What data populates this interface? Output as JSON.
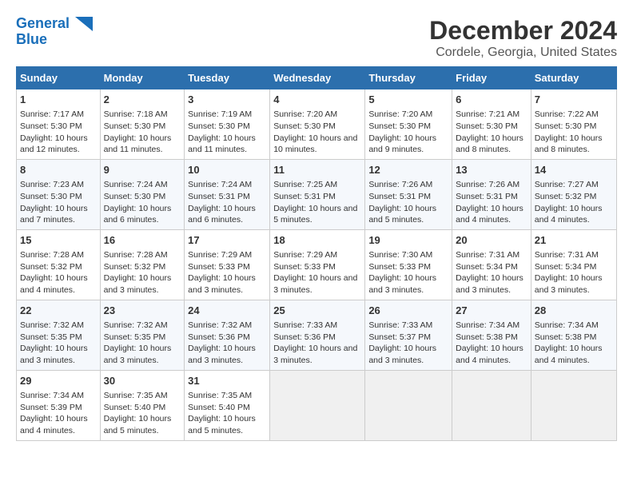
{
  "header": {
    "logo_line1": "General",
    "logo_line2": "Blue",
    "title": "December 2024",
    "subtitle": "Cordele, Georgia, United States"
  },
  "days_of_week": [
    "Sunday",
    "Monday",
    "Tuesday",
    "Wednesday",
    "Thursday",
    "Friday",
    "Saturday"
  ],
  "weeks": [
    [
      {
        "day": "1",
        "content": "Sunrise: 7:17 AM\nSunset: 5:30 PM\nDaylight: 10 hours and 12 minutes."
      },
      {
        "day": "2",
        "content": "Sunrise: 7:18 AM\nSunset: 5:30 PM\nDaylight: 10 hours and 11 minutes."
      },
      {
        "day": "3",
        "content": "Sunrise: 7:19 AM\nSunset: 5:30 PM\nDaylight: 10 hours and 11 minutes."
      },
      {
        "day": "4",
        "content": "Sunrise: 7:20 AM\nSunset: 5:30 PM\nDaylight: 10 hours and 10 minutes."
      },
      {
        "day": "5",
        "content": "Sunrise: 7:20 AM\nSunset: 5:30 PM\nDaylight: 10 hours and 9 minutes."
      },
      {
        "day": "6",
        "content": "Sunrise: 7:21 AM\nSunset: 5:30 PM\nDaylight: 10 hours and 8 minutes."
      },
      {
        "day": "7",
        "content": "Sunrise: 7:22 AM\nSunset: 5:30 PM\nDaylight: 10 hours and 8 minutes."
      }
    ],
    [
      {
        "day": "8",
        "content": "Sunrise: 7:23 AM\nSunset: 5:30 PM\nDaylight: 10 hours and 7 minutes."
      },
      {
        "day": "9",
        "content": "Sunrise: 7:24 AM\nSunset: 5:30 PM\nDaylight: 10 hours and 6 minutes."
      },
      {
        "day": "10",
        "content": "Sunrise: 7:24 AM\nSunset: 5:31 PM\nDaylight: 10 hours and 6 minutes."
      },
      {
        "day": "11",
        "content": "Sunrise: 7:25 AM\nSunset: 5:31 PM\nDaylight: 10 hours and 5 minutes."
      },
      {
        "day": "12",
        "content": "Sunrise: 7:26 AM\nSunset: 5:31 PM\nDaylight: 10 hours and 5 minutes."
      },
      {
        "day": "13",
        "content": "Sunrise: 7:26 AM\nSunset: 5:31 PM\nDaylight: 10 hours and 4 minutes."
      },
      {
        "day": "14",
        "content": "Sunrise: 7:27 AM\nSunset: 5:32 PM\nDaylight: 10 hours and 4 minutes."
      }
    ],
    [
      {
        "day": "15",
        "content": "Sunrise: 7:28 AM\nSunset: 5:32 PM\nDaylight: 10 hours and 4 minutes."
      },
      {
        "day": "16",
        "content": "Sunrise: 7:28 AM\nSunset: 5:32 PM\nDaylight: 10 hours and 3 minutes."
      },
      {
        "day": "17",
        "content": "Sunrise: 7:29 AM\nSunset: 5:33 PM\nDaylight: 10 hours and 3 minutes."
      },
      {
        "day": "18",
        "content": "Sunrise: 7:29 AM\nSunset: 5:33 PM\nDaylight: 10 hours and 3 minutes."
      },
      {
        "day": "19",
        "content": "Sunrise: 7:30 AM\nSunset: 5:33 PM\nDaylight: 10 hours and 3 minutes."
      },
      {
        "day": "20",
        "content": "Sunrise: 7:31 AM\nSunset: 5:34 PM\nDaylight: 10 hours and 3 minutes."
      },
      {
        "day": "21",
        "content": "Sunrise: 7:31 AM\nSunset: 5:34 PM\nDaylight: 10 hours and 3 minutes."
      }
    ],
    [
      {
        "day": "22",
        "content": "Sunrise: 7:32 AM\nSunset: 5:35 PM\nDaylight: 10 hours and 3 minutes."
      },
      {
        "day": "23",
        "content": "Sunrise: 7:32 AM\nSunset: 5:35 PM\nDaylight: 10 hours and 3 minutes."
      },
      {
        "day": "24",
        "content": "Sunrise: 7:32 AM\nSunset: 5:36 PM\nDaylight: 10 hours and 3 minutes."
      },
      {
        "day": "25",
        "content": "Sunrise: 7:33 AM\nSunset: 5:36 PM\nDaylight: 10 hours and 3 minutes."
      },
      {
        "day": "26",
        "content": "Sunrise: 7:33 AM\nSunset: 5:37 PM\nDaylight: 10 hours and 3 minutes."
      },
      {
        "day": "27",
        "content": "Sunrise: 7:34 AM\nSunset: 5:38 PM\nDaylight: 10 hours and 4 minutes."
      },
      {
        "day": "28",
        "content": "Sunrise: 7:34 AM\nSunset: 5:38 PM\nDaylight: 10 hours and 4 minutes."
      }
    ],
    [
      {
        "day": "29",
        "content": "Sunrise: 7:34 AM\nSunset: 5:39 PM\nDaylight: 10 hours and 4 minutes."
      },
      {
        "day": "30",
        "content": "Sunrise: 7:35 AM\nSunset: 5:40 PM\nDaylight: 10 hours and 5 minutes."
      },
      {
        "day": "31",
        "content": "Sunrise: 7:35 AM\nSunset: 5:40 PM\nDaylight: 10 hours and 5 minutes."
      },
      {
        "day": "",
        "content": ""
      },
      {
        "day": "",
        "content": ""
      },
      {
        "day": "",
        "content": ""
      },
      {
        "day": "",
        "content": ""
      }
    ]
  ]
}
